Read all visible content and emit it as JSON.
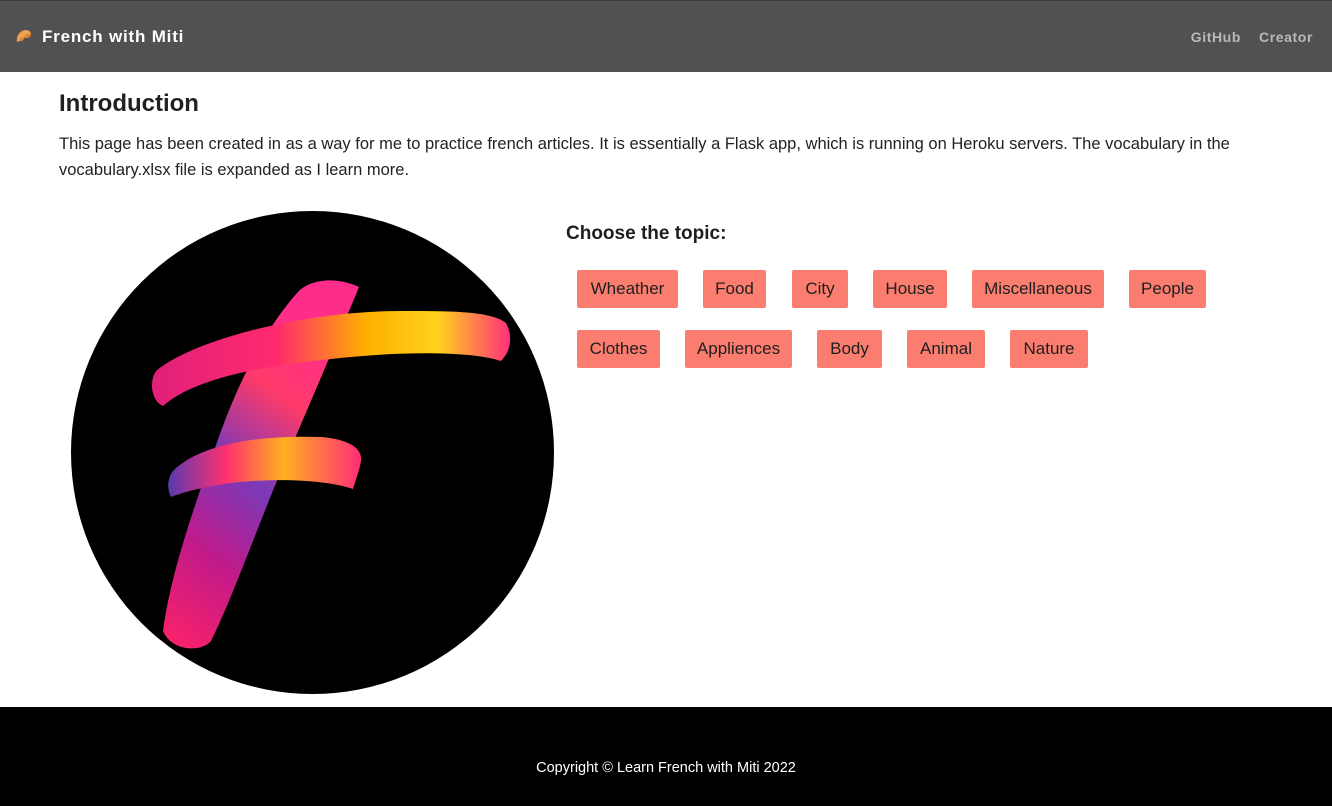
{
  "navbar": {
    "brand": "French with Miti",
    "logo_icon": "croissant-icon",
    "links": [
      "GitHub",
      "Creator"
    ]
  },
  "intro": {
    "title": "Introduction",
    "text": "This page has been created in as a way for me to practice french articles. It is essentially a Flask app, which is running on Heroku servers. The vocabulary in the vocabulary.xlsx file is expanded as I learn more."
  },
  "topics": {
    "heading": "Choose the topic:",
    "buttons": [
      "Wheather",
      "Food",
      "City",
      "House",
      "Miscellaneous",
      "People",
      "Clothes",
      "Appliences",
      "Body",
      "Animal",
      "Nature"
    ]
  },
  "footer": {
    "text": "Copyright © Learn French with Miti 2022"
  },
  "colors": {
    "navbar_bg": "#515151",
    "button_bg": "#fa7d6f",
    "footer_bg": "#000000"
  }
}
